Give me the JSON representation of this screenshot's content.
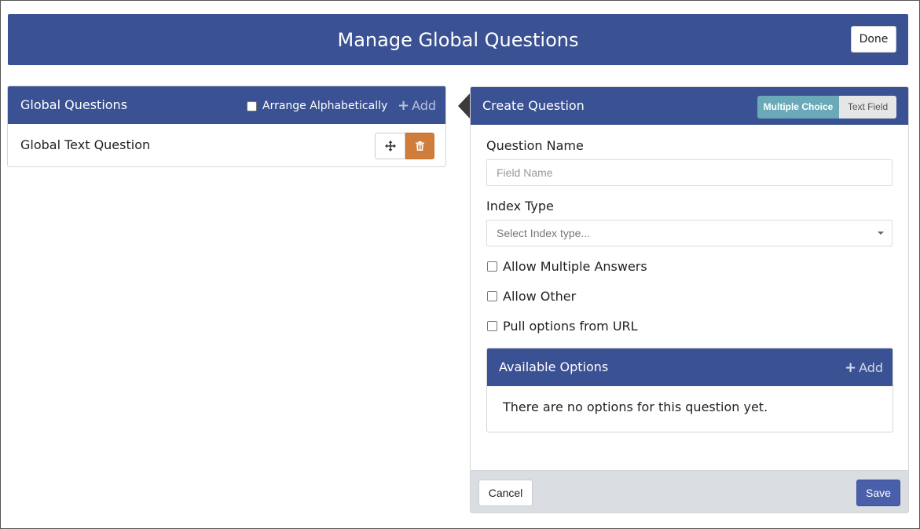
{
  "header": {
    "title": "Manage Global Questions",
    "done_label": "Done"
  },
  "left_panel": {
    "title": "Global Questions",
    "arrange_label": "Arrange Alphabetically",
    "arrange_checked": false,
    "add_label": "Add",
    "questions": [
      {
        "label": "Global Text Question"
      }
    ]
  },
  "right_panel": {
    "title": "Create Question",
    "type_options": [
      "Multiple Choice",
      "Text Field"
    ],
    "selected_type": "Multiple Choice",
    "question_name_label": "Question Name",
    "question_name_placeholder": "Field Name",
    "index_type_label": "Index Type",
    "index_type_placeholder": "Select Index type...",
    "checkboxes": [
      {
        "label": "Allow Multiple Answers",
        "checked": false
      },
      {
        "label": "Allow Other",
        "checked": false
      },
      {
        "label": "Pull options from URL",
        "checked": false
      }
    ],
    "options": {
      "title": "Available Options",
      "add_label": "Add",
      "empty_text": "There are no options for this question yet."
    },
    "cancel_label": "Cancel",
    "save_label": "Save"
  },
  "colors": {
    "header_blue": "#3a5193",
    "delete_orange": "#d07c3a",
    "toggle_active": "#6aaab8",
    "save_blue": "#4a5fa9"
  },
  "icons": {
    "add": "plus-icon",
    "move": "move-arrows-icon",
    "delete": "trash-icon",
    "dropdown": "caret-down-icon"
  }
}
